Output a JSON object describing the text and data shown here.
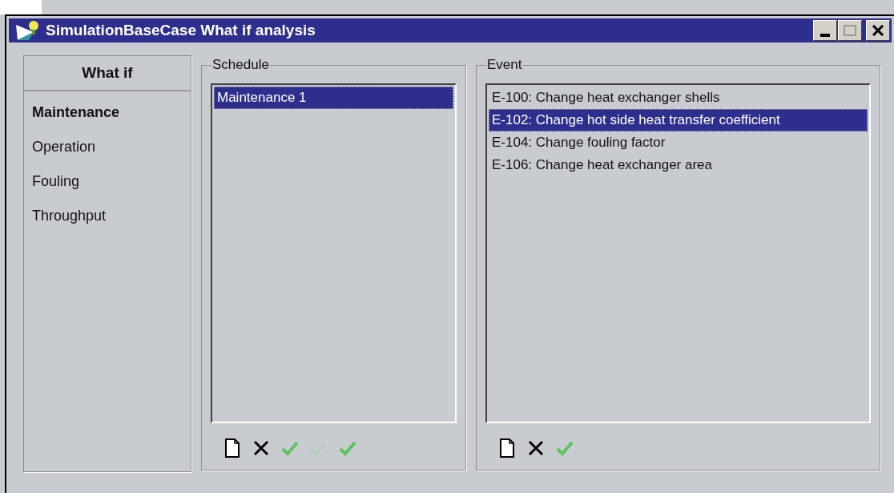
{
  "window": {
    "title": "SimulationBaseCase What if analysis"
  },
  "sidebar": {
    "title": "What if",
    "items": [
      {
        "label": "Maintenance",
        "selected": true
      },
      {
        "label": "Operation",
        "selected": false
      },
      {
        "label": "Fouling",
        "selected": false
      },
      {
        "label": "Throughput",
        "selected": false
      }
    ]
  },
  "schedule": {
    "title": "Schedule",
    "items": [
      {
        "label": "Maintenance 1",
        "selected": true
      }
    ],
    "toolbar": [
      {
        "kind": "new",
        "disabled": false
      },
      {
        "kind": "delete",
        "disabled": false
      },
      {
        "kind": "apply",
        "disabled": false
      },
      {
        "kind": "apply",
        "disabled": true
      },
      {
        "kind": "apply",
        "disabled": false
      }
    ]
  },
  "event": {
    "title": "Event",
    "items": [
      {
        "label": "E-100: Change heat exchanger shells",
        "selected": false
      },
      {
        "label": "E-102: Change hot side heat transfer coefficient",
        "selected": true
      },
      {
        "label": "E-104: Change fouling factor",
        "selected": false
      },
      {
        "label": "E-106: Change heat exchanger area",
        "selected": false
      }
    ],
    "toolbar": [
      {
        "kind": "new",
        "disabled": false
      },
      {
        "kind": "delete",
        "disabled": false
      },
      {
        "kind": "apply",
        "disabled": false
      }
    ]
  }
}
